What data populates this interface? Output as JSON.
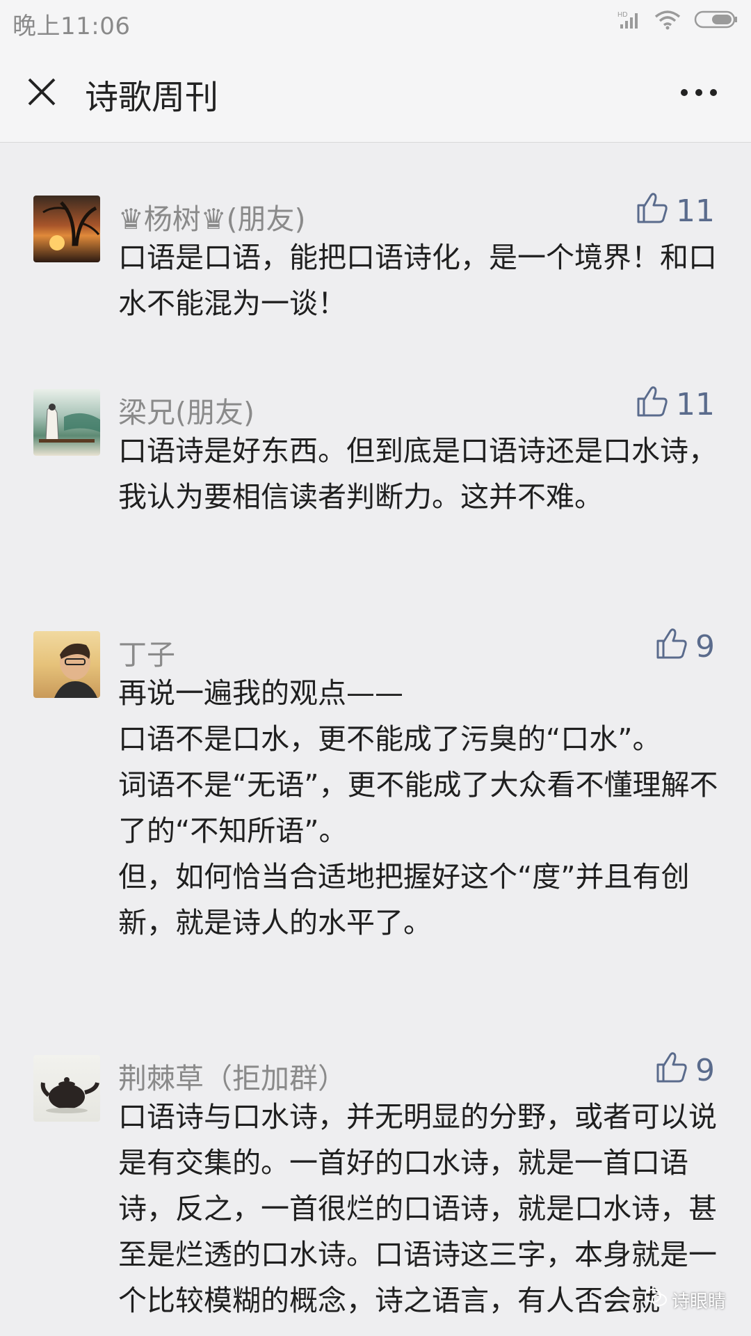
{
  "status_bar": {
    "time": "晚上11:06",
    "icons": [
      "hd-signal-icon",
      "wifi-icon",
      "battery-icon"
    ]
  },
  "nav": {
    "title": "诗歌周刊",
    "close_icon": "close-icon",
    "more_icon": "more-dots-icon"
  },
  "comments": [
    {
      "author": "♛杨树♛(朋友)",
      "likes": "11",
      "lines": [
        "口语是口语，能把口语诗化，是一个境界！和口水不能混为一谈！"
      ]
    },
    {
      "author": "梁兄(朋友)",
      "likes": "11",
      "lines": [
        "口语诗是好东西。但到底是口语诗还是口水诗，我认为要相信读者判断力。这并不难。"
      ]
    },
    {
      "author": "丁子",
      "likes": "9",
      "lines": [
        "再说一遍我的观点——",
        "口语不是口水，更不能成了污臭的“口水”。",
        "词语不是“无语”，更不能成了大众看不懂理解不了的“不知所语”。",
        "但，如何恰当合适地把握好这个“度”并且有创新，就是诗人的水平了。"
      ]
    },
    {
      "author": "荆棘草（拒加群）",
      "likes": "9",
      "lines": [
        "口语诗与口水诗，并无明显的分野，或者可以说是有交集的。一首好的口水诗，就是一首口语诗，反之，一首很烂的口语诗，就是口水诗，甚至是烂透的口水诗。口语诗这三字，本身就是一个比较模糊的概念，诗之语言，有人否会就"
      ]
    }
  ],
  "watermark": {
    "text": "诗眼睛"
  },
  "colors": {
    "background": "#eeeef0",
    "header": "#f5f5f6",
    "like_accent": "#5a6b8c",
    "author_text": "#8a8a8a"
  }
}
